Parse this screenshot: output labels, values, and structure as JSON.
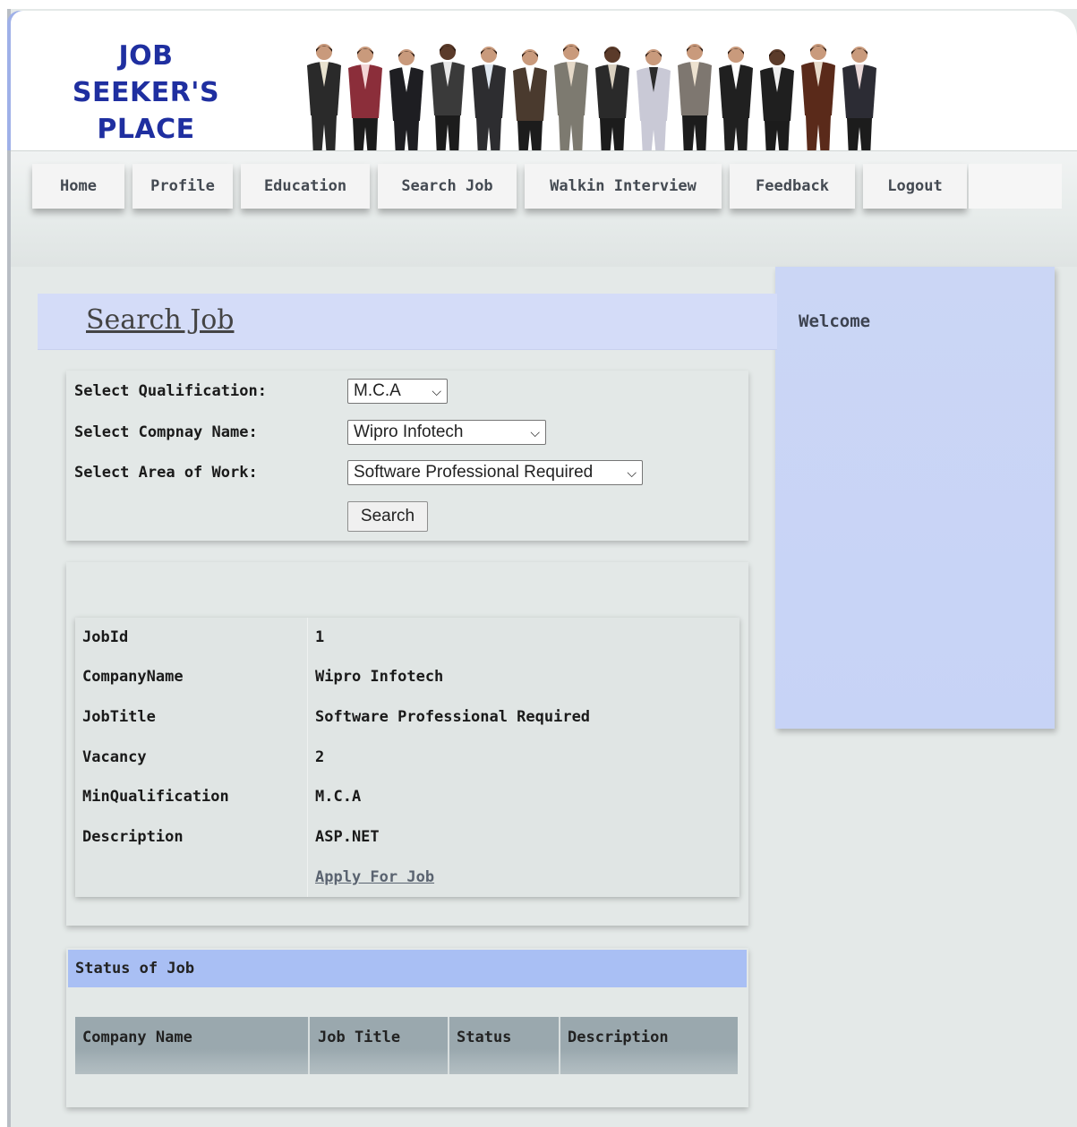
{
  "logo": {
    "line1": "JOB",
    "line2": "SEEKER'S",
    "line3": "PLACE"
  },
  "nav": [
    "Home",
    "Profile",
    "Education",
    "Search Job",
    "Walkin Interview",
    "Feedback",
    "Logout"
  ],
  "search": {
    "heading": "Search Job",
    "qualification_label": "Select Qualification:",
    "qualification_value": "M.C.A",
    "company_label": "Select Compnay Name:",
    "company_value": "Wipro Infotech",
    "area_label": "Select Area of Work:",
    "area_value": "Software Professional Required",
    "button": "Search"
  },
  "sidebar": {
    "welcome": "Welcome"
  },
  "job": {
    "rows": [
      {
        "label": "JobId",
        "value": "1"
      },
      {
        "label": "CompanyName",
        "value": "Wipro Infotech"
      },
      {
        "label": "JobTitle",
        "value": "Software Professional Required"
      },
      {
        "label": "Vacancy",
        "value": "2"
      },
      {
        "label": "MinQualification",
        "value": "M.C.A"
      },
      {
        "label": "Description",
        "value": "ASP.NET"
      }
    ],
    "apply_link": "Apply For Job"
  },
  "status": {
    "title": "Status of Job",
    "columns": [
      "Company Name",
      "Job Title",
      "Status",
      "Description"
    ]
  },
  "colors": {
    "brand_blue": "#1f2fa0",
    "header_band": "#d4dcf8",
    "sidebar": "#cbd6f5",
    "status_head": "#a9bff4"
  }
}
